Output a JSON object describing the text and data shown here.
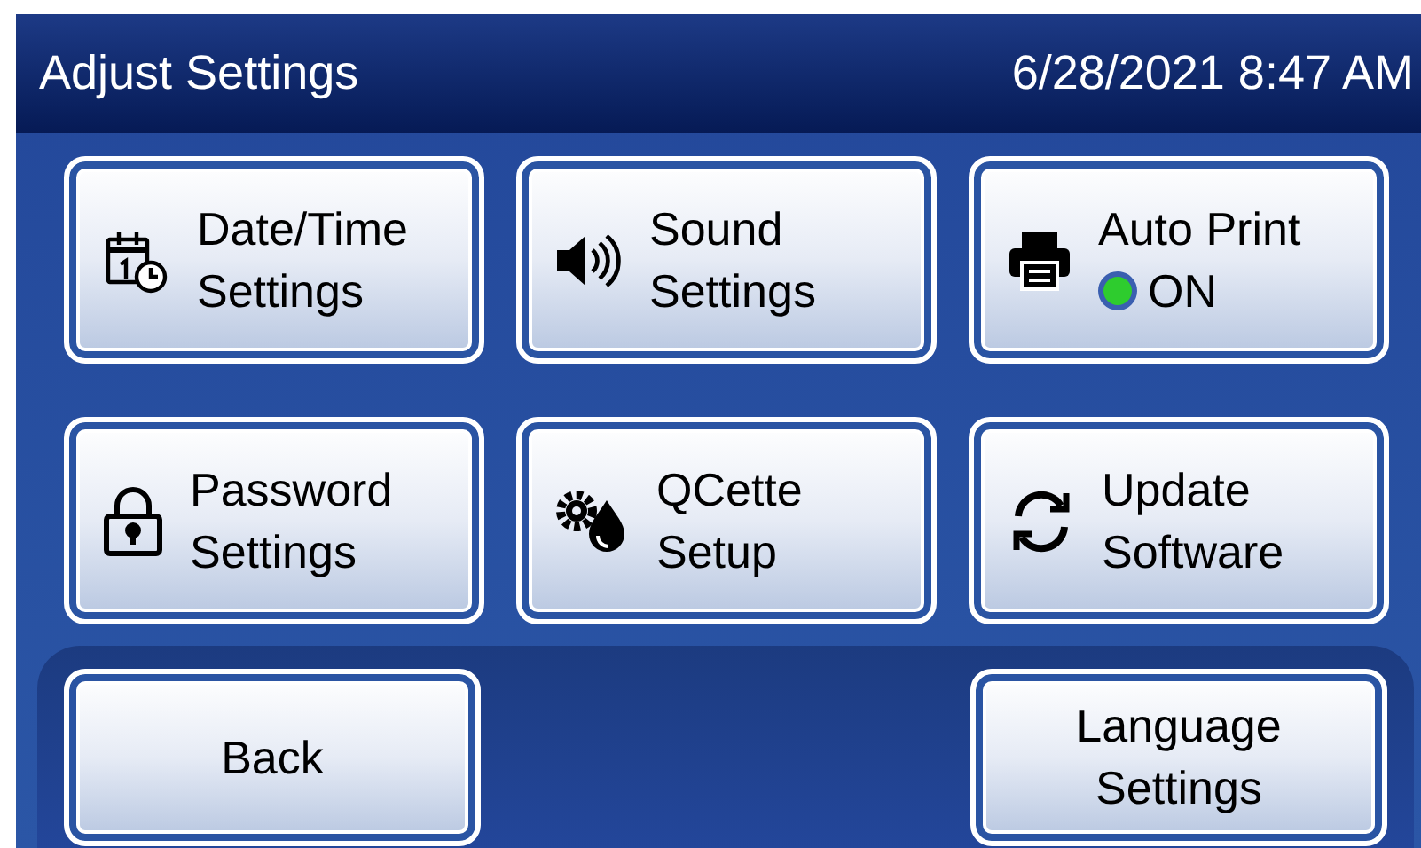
{
  "header": {
    "title": "Adjust Settings",
    "datetime": "6/28/2021 8:47 AM"
  },
  "buttons": [
    {
      "lines": [
        "Date/Time",
        "Settings"
      ]
    },
    {
      "lines": [
        "Sound",
        "Settings"
      ]
    },
    {
      "lines": [
        "Auto Print"
      ],
      "status": {
        "on": true,
        "label": "ON"
      }
    },
    {
      "lines": [
        "Password",
        "Settings"
      ]
    },
    {
      "lines": [
        "QCette",
        "Setup"
      ]
    },
    {
      "lines": [
        "Update",
        "Software"
      ]
    }
  ],
  "footer_buttons": [
    {
      "lines": [
        "Back"
      ]
    },
    {
      "lines": [
        "Language",
        "Settings"
      ]
    }
  ]
}
